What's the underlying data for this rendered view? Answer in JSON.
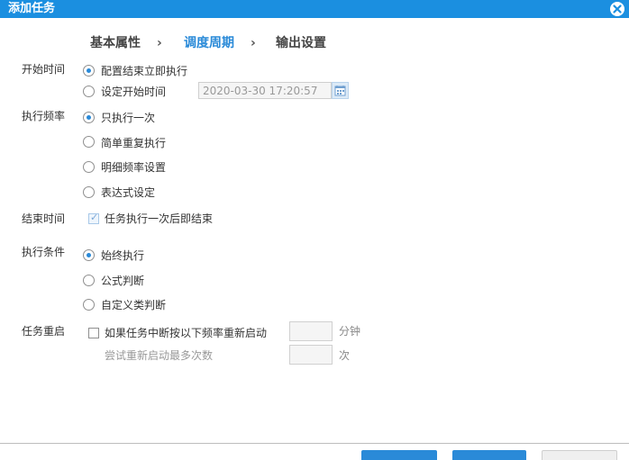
{
  "dialog": {
    "title": "添加任务"
  },
  "steps": [
    {
      "label": "基本属性",
      "active": false
    },
    {
      "label": "调度周期",
      "active": true
    },
    {
      "label": "输出设置",
      "active": false
    }
  ],
  "step_separator": "›",
  "start_time": {
    "label": "开始时间",
    "options": [
      {
        "label": "配置结束立即执行",
        "checked": true
      },
      {
        "label": "设定开始时间",
        "checked": false
      }
    ],
    "datetime_value": "2020-03-30 17:20:57"
  },
  "frequency": {
    "label": "执行频率",
    "options": [
      {
        "label": "只执行一次",
        "checked": true
      },
      {
        "label": "简单重复执行",
        "checked": false
      },
      {
        "label": "明细频率设置",
        "checked": false
      },
      {
        "label": "表达式设定",
        "checked": false
      }
    ]
  },
  "end_time": {
    "label": "结束时间",
    "checkbox_label": "任务执行一次后即结束",
    "checked": true
  },
  "condition": {
    "label": "执行条件",
    "options": [
      {
        "label": "始终执行",
        "checked": true
      },
      {
        "label": "公式判断",
        "checked": false
      },
      {
        "label": "自定义类判断",
        "checked": false
      }
    ]
  },
  "restart": {
    "label": "任务重启",
    "checkbox_label": "如果任务中断按以下频率重新启动",
    "checked": false,
    "interval_unit": "分钟",
    "retry_label": "尝试重新启动最多次数",
    "retry_unit": "次"
  },
  "colors": {
    "accent": "#2a8ad8",
    "titlebar": "#1b8fe0"
  }
}
